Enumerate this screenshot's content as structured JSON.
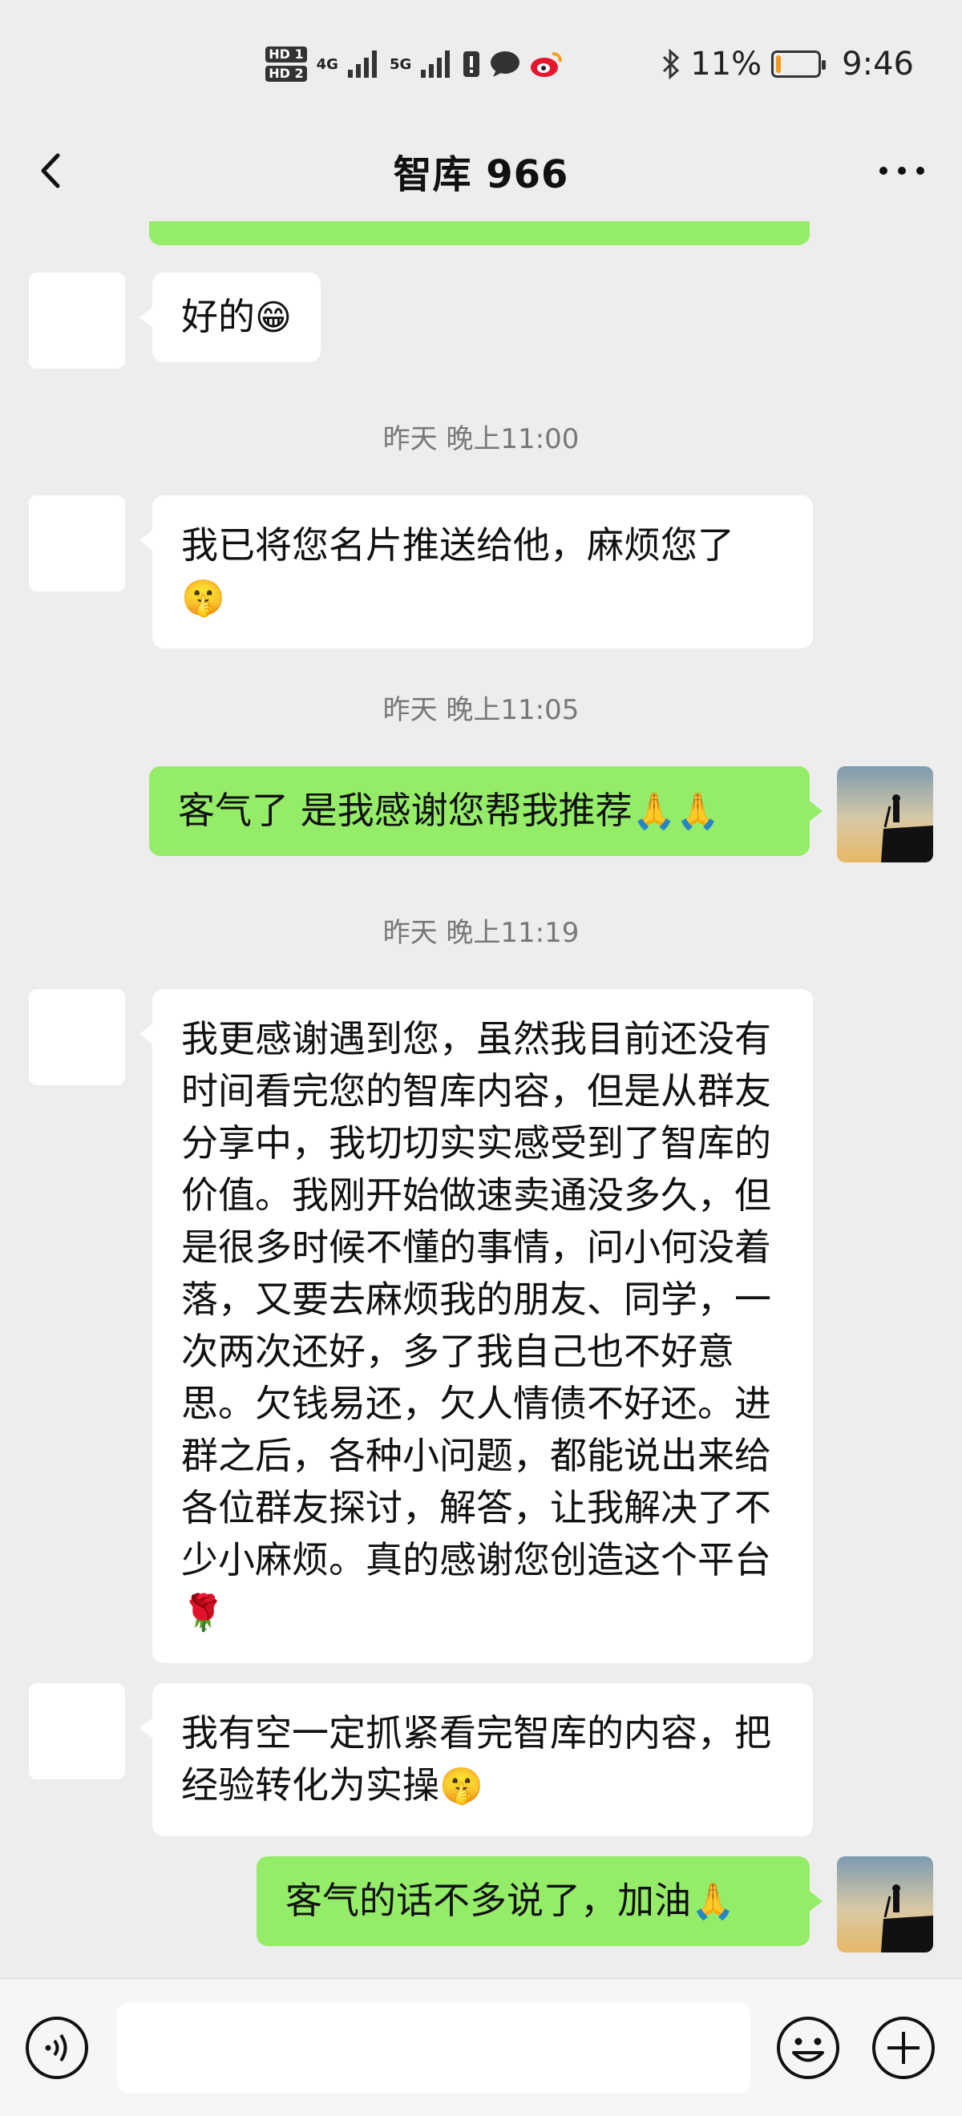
{
  "status_bar": {
    "hd1": "HD 1",
    "hd2": "HD 2",
    "signal1": "4G",
    "signal2": "5G",
    "battery": "11%",
    "battery_level": 0.11,
    "time": "9:46",
    "icons": [
      "bluetooth-icon",
      "alert-icon",
      "chat-bubble-icon",
      "weibo-icon"
    ]
  },
  "header": {
    "title": "智库 966"
  },
  "messages": [
    {
      "side": "in",
      "text": "好的",
      "emoji": "😁"
    },
    {
      "type": "time",
      "text": "昨天 晚上11:00"
    },
    {
      "side": "in",
      "text": "我已将您名片推送给他，麻烦您了",
      "emoji": "🤫"
    },
    {
      "type": "time",
      "text": "昨天 晚上11:05"
    },
    {
      "side": "out",
      "text": "客气了 是我感谢您帮我推荐",
      "emoji": "🙏🙏"
    },
    {
      "type": "time",
      "text": "昨天 晚上11:19"
    },
    {
      "side": "in",
      "text": "我更感谢遇到您，虽然我目前还没有时间看完您的智库内容，但是从群友分享中，我切切实实感受到了智库的价值。我刚开始做速卖通没多久，但是很多时候不懂的事情，问小何没着落，又要去麻烦我的朋友、同学，一次两次还好，多了我自己也不好意思。欠钱易还，欠人情债不好还。进群之后，各种小问题，都能说出来给各位群友探讨，解答，让我解决了不少小麻烦。真的感谢您创造这个平台",
      "emoji": "🌹"
    },
    {
      "side": "in",
      "text": "我有空一定抓紧看完智库的内容，把经验转化为实操",
      "emoji": "🤫"
    },
    {
      "side": "out",
      "text": "客气的话不多说了，加油",
      "emoji": "🙏"
    }
  ],
  "colors": {
    "background": "#ededed",
    "outgoing_bubble": "#95ec69",
    "incoming_bubble": "#ffffff",
    "battery_fill": "#f29a1a"
  }
}
